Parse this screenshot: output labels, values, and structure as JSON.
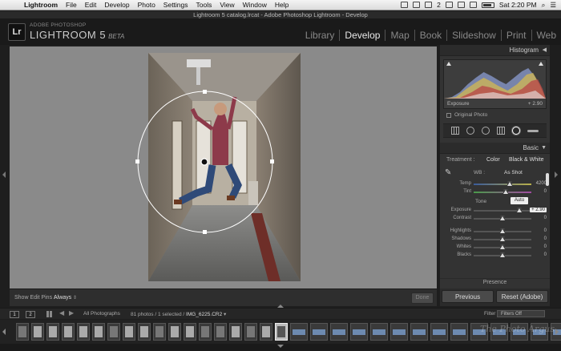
{
  "menubar": {
    "apple_icon": "apple-logo",
    "items": [
      "Lightroom",
      "File",
      "Edit",
      "Develop",
      "Photo",
      "Settings",
      "Tools",
      "View",
      "Window",
      "Help"
    ],
    "status_badge": "2",
    "clock": "Sat 2:20 PM"
  },
  "window": {
    "title": "Lightroom 5 catalog.lrcat - Adobe Photoshop Lightroom - Develop"
  },
  "identity": {
    "logo": "Lr",
    "company": "ADOBE PHOTOSHOP",
    "product": "LIGHTROOM 5",
    "edition": "BETA"
  },
  "modules": [
    {
      "label": "Library",
      "active": false
    },
    {
      "label": "Develop",
      "active": true
    },
    {
      "label": "Map",
      "active": false
    },
    {
      "label": "Book",
      "active": false
    },
    {
      "label": "Slideshow",
      "active": false
    },
    {
      "label": "Print",
      "active": false
    },
    {
      "label": "Web",
      "active": false
    }
  ],
  "toolbar": {
    "edit_pins_label": "Show Edit Pins :",
    "edit_pins_value": "Always",
    "done_label": "Done"
  },
  "histogram": {
    "title": "Histogram",
    "exposure_label": "Exposure",
    "exposure_value": "+ 2.90",
    "original_photo_label": "Original Photo"
  },
  "basic": {
    "title": "Basic",
    "treatment_label": "Treatment :",
    "treatment_color": "Color",
    "treatment_bw": "Black & White",
    "wb_label": "WB :",
    "wb_value": "As Shot",
    "tone_label": "Tone",
    "auto_label": "Auto",
    "sliders_wb": [
      {
        "label": "Temp",
        "value": "4200",
        "position": 0.63
      },
      {
        "label": "Tint",
        "value": "0",
        "position": 0.55
      }
    ],
    "sliders_tone": [
      {
        "label": "Exposure",
        "value": "+ 2.90",
        "position": 0.79
      },
      {
        "label": "Contrast",
        "value": "0",
        "position": 0.5
      }
    ],
    "sliders_presence": [
      {
        "label": "Highlights",
        "value": "0",
        "position": 0.5
      },
      {
        "label": "Shadows",
        "value": "0",
        "position": 0.5
      },
      {
        "label": "Whites",
        "value": "0",
        "position": 0.5
      },
      {
        "label": "Blacks",
        "value": "0",
        "position": 0.5
      }
    ],
    "presence_label": "Presence"
  },
  "buttons": {
    "previous": "Previous",
    "reset": "Reset (Adobe)"
  },
  "filmhead": {
    "screen1": "1",
    "screen2": "2",
    "source": "All Photographs",
    "count": "81 photos / 1 selected /",
    "filename": "IMG_6225.CR2",
    "filter_label": "Filter :",
    "filter_value": "Filters Off"
  },
  "filmstrip": {
    "watermark": "The Photo Argus",
    "selected_index": 17
  }
}
